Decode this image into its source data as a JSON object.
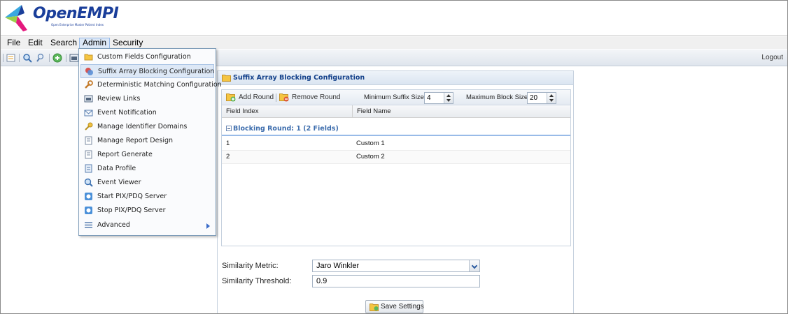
{
  "app": {
    "logo_text": "OpenEMPI",
    "logo_tagline": "Open Enterprise Master Patient Index"
  },
  "menubar": {
    "items": [
      "File",
      "Edit",
      "Search",
      "Admin",
      "Security"
    ],
    "active": "Admin"
  },
  "toolbar": {
    "logout_label": "Logout",
    "icons": [
      "report-icon",
      "search-icon",
      "advanced-search-icon",
      "add-icon",
      "view-icon"
    ]
  },
  "admin_menu": {
    "items": [
      {
        "label": "Custom Fields Configuration",
        "icon": "folder-icon"
      },
      {
        "label": "Suffix Array Blocking Configuration",
        "icon": "blocking-icon"
      },
      {
        "label": "Deterministic Matching Configuration",
        "icon": "wrench-icon"
      },
      {
        "label": "Review Links",
        "icon": "review-icon"
      },
      {
        "label": "Event Notification",
        "icon": "notification-icon"
      },
      {
        "label": "Manage Identifier Domains",
        "icon": "key-icon"
      },
      {
        "label": "Manage Report Design",
        "icon": "report-design-icon"
      },
      {
        "label": "Report Generate",
        "icon": "report-generate-icon"
      },
      {
        "label": "Data Profile",
        "icon": "data-profile-icon"
      },
      {
        "label": "Event Viewer",
        "icon": "event-viewer-icon"
      },
      {
        "label": "Start PIX/PDQ Server",
        "icon": "start-server-icon"
      },
      {
        "label": "Stop PIX/PDQ Server",
        "icon": "stop-server-icon"
      },
      {
        "label": "Advanced",
        "icon": "advanced-icon"
      }
    ],
    "highlighted": "Suffix Array Blocking Configuration"
  },
  "panel": {
    "title": "Suffix Array Blocking Configuration",
    "add_round_label": "Add Round",
    "remove_round_label": "Remove Round",
    "min_suffix_label": "Minimum Suffix Size:",
    "min_suffix_value": "4",
    "max_block_label": "Maximum Block Size:",
    "max_block_value": "20",
    "columns": [
      "Field Index",
      "Field Name"
    ],
    "group_label": "Blocking Round: 1 (2 Fields)",
    "rows": [
      {
        "index": "1",
        "name": "Custom 1"
      },
      {
        "index": "2",
        "name": "Custom 2"
      }
    ],
    "similarity_metric_label": "Similarity Metric:",
    "similarity_metric_value": "Jaro Winkler",
    "similarity_threshold_label": "Similarity Threshold:",
    "similarity_threshold_value": "0.9",
    "save_label": "Save Settings"
  },
  "colors": {
    "menu_highlight": "#dde8f6",
    "panel_title": "#15428b",
    "group_text": "#3d6dad",
    "logo_blue": "#1a3e9a"
  }
}
